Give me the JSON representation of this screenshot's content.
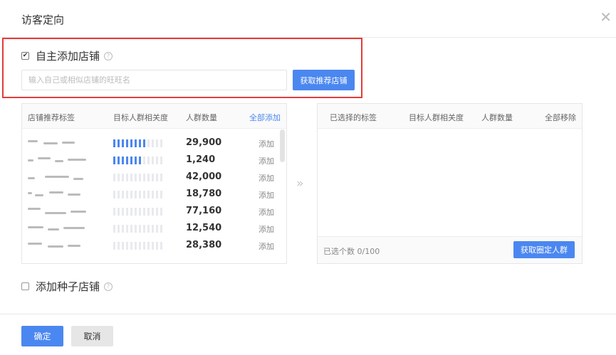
{
  "dialog": {
    "title": "访客定向",
    "close_icon": "close-icon"
  },
  "self_add": {
    "label": "自主添加店铺",
    "checked": true,
    "input_placeholder": "输入自己或相似店铺的旺旺名",
    "get_button": "获取推荐店铺"
  },
  "left_table": {
    "headers": [
      "店铺推荐标签",
      "目标人群相关度",
      "人群数量",
      "全部添加"
    ],
    "rows": [
      {
        "relevance": 8,
        "count": "29,900",
        "action": "添加"
      },
      {
        "relevance": 7,
        "count": "1,240",
        "action": "添加"
      },
      {
        "relevance": 0,
        "count": "42,000",
        "action": "添加"
      },
      {
        "relevance": 0,
        "count": "18,780",
        "action": "添加"
      },
      {
        "relevance": 0,
        "count": "77,160",
        "action": "添加"
      },
      {
        "relevance": 0,
        "count": "12,540",
        "action": "添加"
      },
      {
        "relevance": 0,
        "count": "28,380",
        "action": "添加"
      }
    ]
  },
  "right_table": {
    "headers": [
      "已选择的标签",
      "目标人群相关度",
      "人群数量",
      "全部移除"
    ],
    "selected_count": "已选个数 0/100",
    "crowd_button": "获取圈定人群"
  },
  "seed_shop": {
    "label": "添加种子店铺",
    "checked": false
  },
  "footer": {
    "ok": "确定",
    "cancel": "取消"
  },
  "colors": {
    "primary": "#4b87f0",
    "highlight_border": "#e53c3c"
  }
}
